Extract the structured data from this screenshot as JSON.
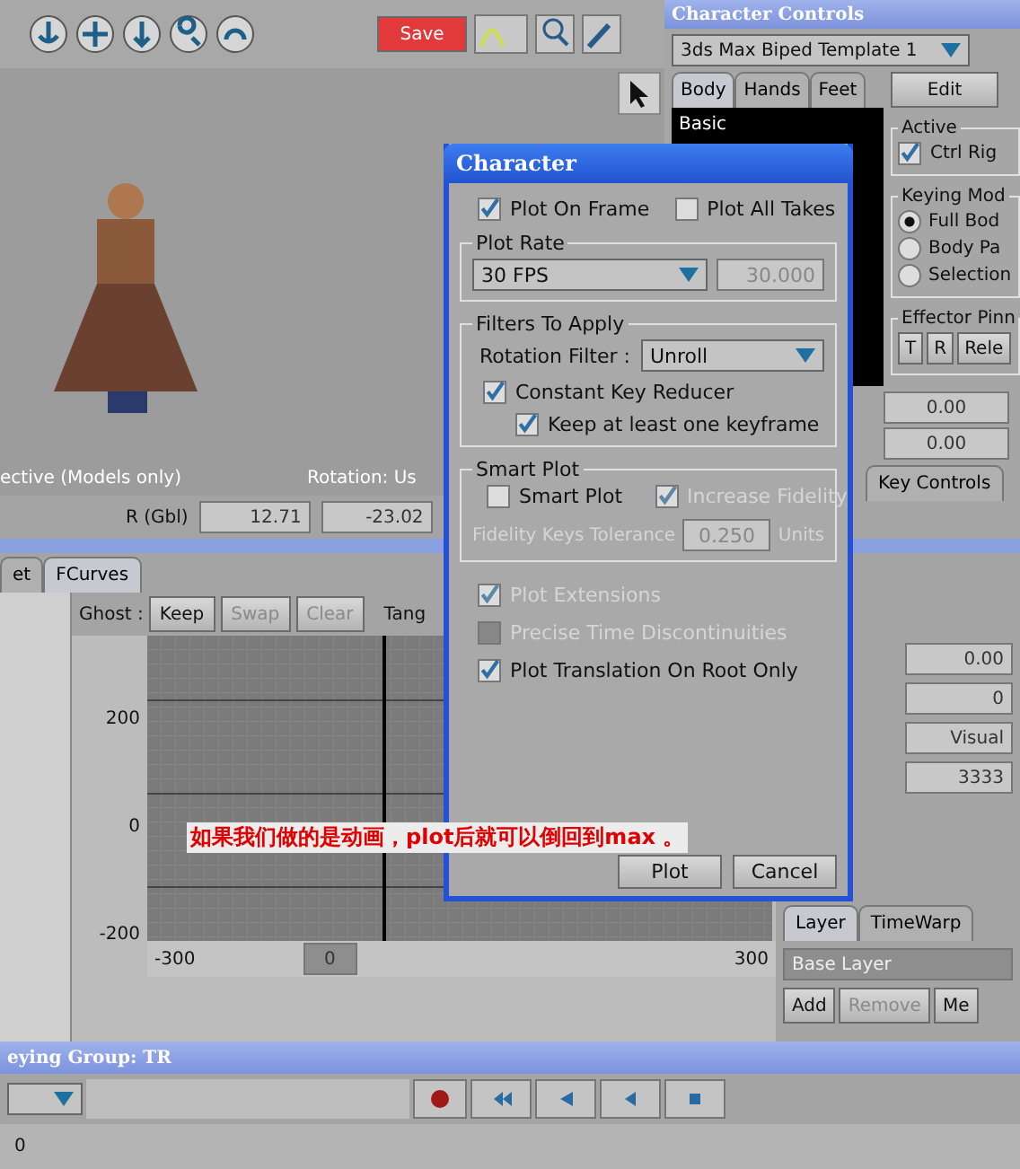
{
  "viewer": {
    "save_button": "Save",
    "viewport_labels": [
      "ective (Models only)",
      "Rotation: Us"
    ],
    "transform": {
      "label": "R (Gbl)",
      "values": [
        "12.71",
        "-23.02"
      ]
    }
  },
  "character_controls": {
    "title": "Character Controls",
    "template": "3ds Max Biped Template 1",
    "tabs": [
      {
        "label": "Body",
        "selected": true
      },
      {
        "label": "Hands",
        "selected": false
      },
      {
        "label": "Feet",
        "selected": false
      }
    ],
    "edit_button": "Edit",
    "view_label": "Basic",
    "active": {
      "title": "Active",
      "label": "Ctrl Rig",
      "checked": true
    },
    "keying_mode": {
      "title": "Keying Mod",
      "options": [
        {
          "label": "Full Bod",
          "selected": true
        },
        {
          "label": "Body Pa",
          "selected": false
        },
        {
          "label": "Selection",
          "selected": false
        }
      ]
    },
    "effector": {
      "title": "Effector Pinn",
      "buttons": [
        "T",
        "R",
        "Rele"
      ]
    },
    "values": [
      "0.00",
      "0.00"
    ],
    "key_controls_tab": "Key Controls"
  },
  "curves": {
    "tabs": [
      {
        "label": "et",
        "selected": false
      },
      {
        "label": "FCurves",
        "selected": true
      }
    ],
    "ghost_label": "Ghost :",
    "ghost_buttons": [
      {
        "label": "Keep",
        "disabled": false
      },
      {
        "label": "Swap",
        "disabled": true
      },
      {
        "label": "Clear",
        "disabled": true
      }
    ],
    "tangent_label": "Tang",
    "y_labels": [
      "200",
      "0",
      "-200"
    ],
    "x_start": "-300",
    "current_frame": "0",
    "x_end": "300"
  },
  "side": {
    "values": [
      "0.00",
      "0",
      "Visual",
      "3333"
    ],
    "layer_tabs": [
      {
        "label": "Layer",
        "selected": true
      },
      {
        "label": "TimeWarp",
        "selected": false
      }
    ],
    "layer": "Base Layer",
    "layer_buttons": [
      {
        "label": "Add",
        "disabled": false
      },
      {
        "label": "Remove",
        "disabled": true
      },
      {
        "label": "Me",
        "disabled": false
      }
    ]
  },
  "transport": {
    "title": "eying Group: TR",
    "frame": "0"
  },
  "dialog": {
    "title": "Character",
    "top_options": [
      {
        "label": "Plot On Frame",
        "checked": true,
        "disabled": false
      },
      {
        "label": "Plot All Takes",
        "checked": false,
        "disabled": false
      }
    ],
    "plot_rate": {
      "title": "Plot Rate",
      "rate": "30 FPS",
      "value": "30.000"
    },
    "filters": {
      "title": "Filters To Apply",
      "rotation_label": "Rotation Filter :",
      "rotation": "Unroll",
      "options": [
        {
          "label": "Constant Key Reducer",
          "checked": true,
          "disabled": false,
          "indented": false
        },
        {
          "label": "Keep at least one keyframe",
          "checked": true,
          "disabled": false,
          "indented": true
        }
      ]
    },
    "smart_plot": {
      "title": "Smart Plot",
      "options": [
        {
          "label": "Smart Plot",
          "checked": false,
          "disabled": false
        },
        {
          "label": "Increase Fidelity",
          "checked": true,
          "disabled": true
        }
      ],
      "tolerance_label": "Fidelity Keys Tolerance",
      "tolerance": "0.250",
      "units": "Units",
      "tolerance_disabled": true
    },
    "options": [
      {
        "label": "Plot Extensions",
        "checked": true,
        "disabled": true
      },
      {
        "label": "Precise Time Discontinuities",
        "checked": false,
        "disabled": true
      },
      {
        "label": "Plot Translation On Root Only",
        "checked": true,
        "disabled": false
      }
    ],
    "buttons": [
      "Plot",
      "Cancel"
    ]
  },
  "annotation": "如果我们做的是动画，plot后就可以倒回到max 。"
}
